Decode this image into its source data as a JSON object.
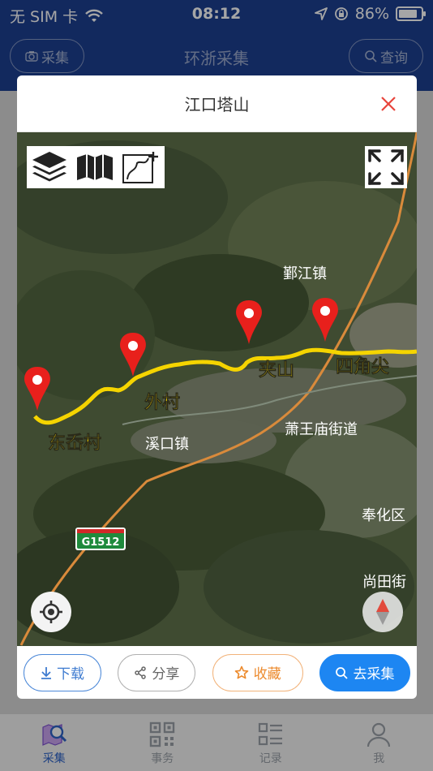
{
  "status_bar": {
    "carrier": "无 SIM 卡",
    "time": "08:12",
    "battery": "86%",
    "battery_level": 0.86
  },
  "app_header": {
    "title": "环浙采集",
    "left_button": "采集",
    "right_button": "查询"
  },
  "modal": {
    "title": "江口塔山",
    "map": {
      "route_color": "#f5d400",
      "marker_color": "#e8201c",
      "markers": [
        {
          "label": "东岙村"
        },
        {
          "label": "外村"
        },
        {
          "label": "夹山"
        },
        {
          "label": "四角尖"
        }
      ],
      "place_labels": [
        "鄞江镇",
        "萧王庙街道",
        "溪口镇",
        "奉化区",
        "尚田街"
      ],
      "highway_badge": "G1512"
    },
    "footer": {
      "download": "下载",
      "share": "分享",
      "collect": "收藏",
      "go_collect": "去采集"
    }
  },
  "tabbar": {
    "items": [
      {
        "label": "采集",
        "active": true
      },
      {
        "label": "事务",
        "active": false
      },
      {
        "label": "记录",
        "active": false
      },
      {
        "label": "我",
        "active": false
      }
    ]
  }
}
